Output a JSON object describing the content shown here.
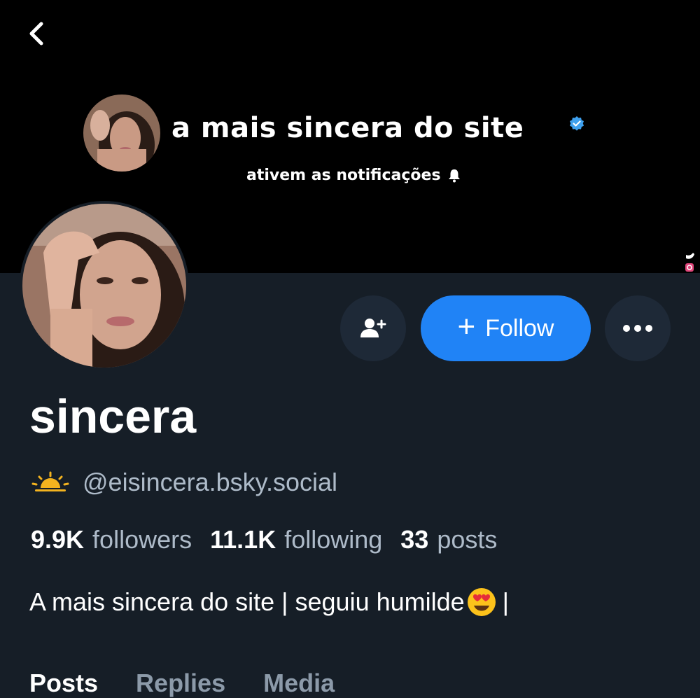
{
  "banner": {
    "title": "a mais sincera do site",
    "subtitle": "ativem as notificações"
  },
  "profile": {
    "display_name": "sincera",
    "handle": "@eisincera.bsky.social",
    "bio_text": "A mais sincera do site | seguiu humilde",
    "bio_suffix": " |"
  },
  "actions": {
    "follow_label": "Follow",
    "follow_plus": "+"
  },
  "stats": {
    "followers_count": "9.9K",
    "followers_label": "followers",
    "following_count": "11.1K",
    "following_label": "following",
    "posts_count": "33",
    "posts_label": "posts"
  },
  "tabs": [
    {
      "label": "Posts",
      "active": true
    },
    {
      "label": "Replies",
      "active": false
    },
    {
      "label": "Media",
      "active": false
    }
  ],
  "icons": {
    "back": "chevron-left-icon",
    "add_user": "user-plus-icon",
    "more": "ellipsis-icon",
    "handle_badge": "sunrise-icon",
    "verified": "verified-badge-icon",
    "bell": "bell-icon",
    "emoji": "heart-eyes-emoji-icon"
  },
  "colors": {
    "background": "#161e27",
    "banner": "#000000",
    "accent": "#2083f6",
    "muted_text": "#aebbc9",
    "circle_button": "#1e2937"
  }
}
